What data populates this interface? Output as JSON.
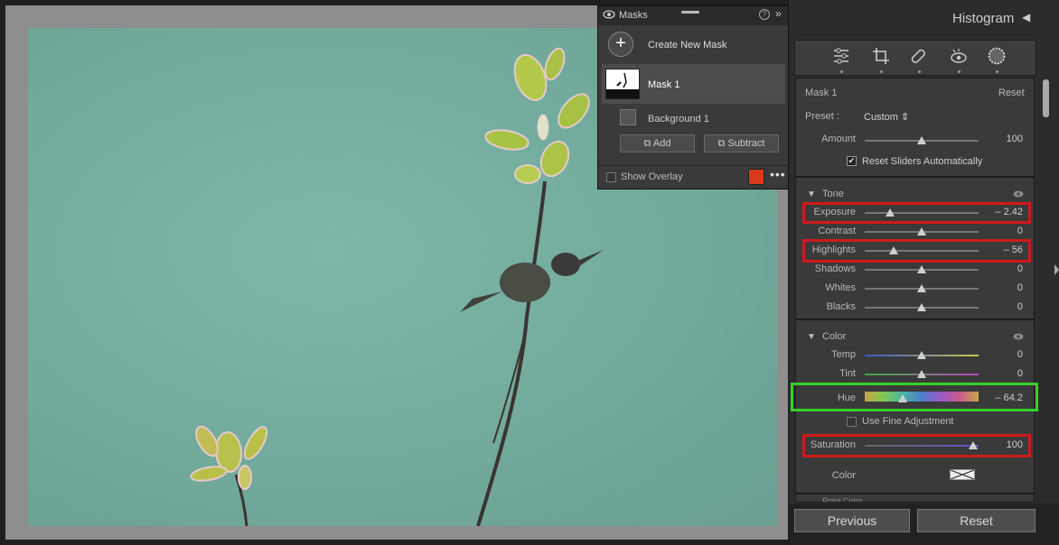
{
  "masks_panel": {
    "title": "Masks",
    "help_icon": "?",
    "collapse_icon": "»",
    "create_label": "Create New Mask",
    "create_icon": "+",
    "mask1_label": "Mask 1",
    "background_label": "Background 1",
    "add_label": "Add",
    "subtract_label": "Subtract",
    "overlay_label": "Show Overlay",
    "overlay_checked": false,
    "overlay_color": "#d93a1b",
    "more_icon": "•••"
  },
  "right_panel": {
    "histogram_title": "Histogram",
    "histogram_arrow": "◀",
    "tools": [
      "sliders-icon",
      "crop-icon",
      "healing-icon",
      "red-eye-icon",
      "masking-icon"
    ],
    "mask_section": {
      "name_label": "Mask 1",
      "reset_label": "Reset",
      "preset_label": "Preset :",
      "preset_value": "Custom",
      "preset_arrows": "⇕",
      "amount_label": "Amount",
      "amount_value": "100",
      "amount_fraction": 0.5,
      "reset_sliders_label": "Reset Sliders Automatically",
      "reset_sliders_checked": true,
      "check_mark": "✔"
    },
    "tone": {
      "title": "Tone",
      "sliders": [
        {
          "label": "Exposure",
          "value": "– 2.42",
          "fraction": 0.22,
          "highlighted": true
        },
        {
          "label": "Contrast",
          "value": "0",
          "fraction": 0.5,
          "highlighted": false
        },
        {
          "label": "Highlights",
          "value": "– 56",
          "fraction": 0.25,
          "highlighted": true
        },
        {
          "label": "Shadows",
          "value": "0",
          "fraction": 0.5,
          "highlighted": false
        },
        {
          "label": "Whites",
          "value": "0",
          "fraction": 0.5,
          "highlighted": false
        },
        {
          "label": "Blacks",
          "value": "0",
          "fraction": 0.5,
          "highlighted": false
        }
      ]
    },
    "color": {
      "title": "Color",
      "temp_label": "Temp",
      "temp_value": "0",
      "tint_label": "Tint",
      "tint_value": "0",
      "hue_label": "Hue",
      "hue_value": "– 64.2",
      "hue_fraction": 0.33,
      "fine_adjust_label": "Use Fine Adjustment",
      "saturation_label": "Saturation",
      "saturation_value": "100",
      "saturation_fraction": 0.95,
      "color_label": "Color"
    },
    "next_section_title": "Point Color",
    "previous_label": "Previous",
    "reset_label": "Reset"
  },
  "highlight_colors": {
    "red": "#d01a1a",
    "green": "#35d12a"
  }
}
